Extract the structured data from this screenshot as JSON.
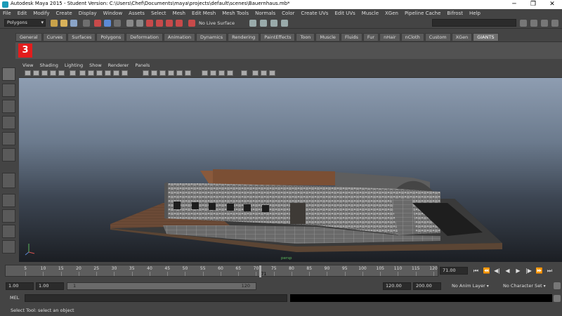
{
  "window": {
    "title": "Autodesk Maya 2015 - Student Version: C:\\Users\\Chef\\Documents\\maya\\projects\\default\\scenes\\Bauernhaus.mb*",
    "minimize": "─",
    "restore": "❐",
    "close": "✕"
  },
  "menubar": [
    "File",
    "Edit",
    "Modify",
    "Create",
    "Display",
    "Window",
    "Assets",
    "Select",
    "Mesh",
    "Edit Mesh",
    "Mesh Tools",
    "Normals",
    "Color",
    "Create UVs",
    "Edit UVs",
    "Muscle",
    "XGen",
    "Pipeline Cache",
    "Bifrost",
    "Help"
  ],
  "statusline": {
    "mode": "Polygons",
    "live_surface": "No Live Surface"
  },
  "shelf": {
    "tabs": [
      "General",
      "Curves",
      "Surfaces",
      "Polygons",
      "Deformation",
      "Animation",
      "Dynamics",
      "Rendering",
      "PaintEffects",
      "Toon",
      "Muscle",
      "Fluids",
      "Fur",
      "nHair",
      "nCloth",
      "Custom",
      "XGen",
      "GIANTS"
    ],
    "active_tab": "GIANTS",
    "giants_icon_label": "3"
  },
  "panel": {
    "menu": [
      "View",
      "Shading",
      "Lighting",
      "Show",
      "Renderer",
      "Panels"
    ],
    "camera_label": "persp"
  },
  "timeslider": {
    "ticks": [
      5,
      10,
      15,
      20,
      25,
      30,
      35,
      40,
      45,
      50,
      55,
      60,
      65,
      70,
      75,
      80,
      85,
      90,
      95,
      100,
      105,
      110,
      115,
      120
    ],
    "start": 1,
    "end": 120,
    "current_frame": 71,
    "current_frame_marker": "71",
    "current_frame_field": "71.00"
  },
  "playback_buttons": [
    "⏮",
    "⏪",
    "◀|",
    "◀",
    "▶",
    "|▶",
    "⏩",
    "⏭"
  ],
  "range": {
    "start_field": "1.00",
    "start_field2": "1.00",
    "slider_left": "1",
    "slider_right": "120",
    "end_field": "120.00",
    "end_field2": "200.00",
    "anim_layer": "No Anim Layer",
    "character_set": "No Character Set"
  },
  "cmdline": {
    "label": "MEL"
  },
  "helpline": {
    "text": "Select Tool: select an object"
  }
}
